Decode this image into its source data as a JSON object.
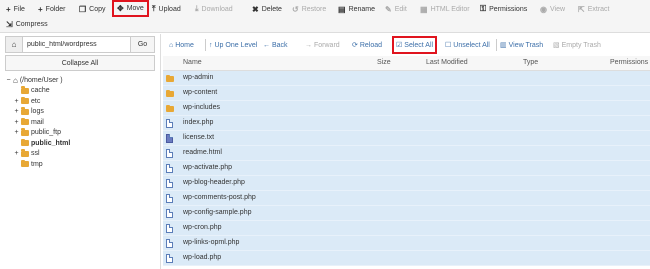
{
  "toolbar": {
    "file": "File",
    "folder": "Folder",
    "copy": "Copy",
    "move": "Move",
    "upload": "Upload",
    "download": "Download",
    "delete": "Delete",
    "restore": "Restore",
    "rename": "Rename",
    "edit": "Edit",
    "html_editor": "HTML Editor",
    "permissions": "Permissions",
    "view": "View",
    "extract": "Extract",
    "compress": "Compress"
  },
  "path": {
    "value": "public_html/wordpress",
    "go": "Go"
  },
  "collapse_all": "Collapse All",
  "tree": [
    {
      "prefix": "−",
      "label": "(/home/User )",
      "bold": false,
      "home": true,
      "indent": 0
    },
    {
      "prefix": "",
      "label": "cache",
      "bold": false,
      "indent": 1
    },
    {
      "prefix": "+",
      "label": "etc",
      "bold": false,
      "indent": 1
    },
    {
      "prefix": "+",
      "label": "logs",
      "bold": false,
      "indent": 1
    },
    {
      "prefix": "+",
      "label": "mail",
      "bold": false,
      "indent": 1
    },
    {
      "prefix": "+",
      "label": "public_ftp",
      "bold": false,
      "indent": 1
    },
    {
      "prefix": "",
      "label": "public_html",
      "bold": true,
      "indent": 1
    },
    {
      "prefix": "+",
      "label": "ssl",
      "bold": false,
      "indent": 1
    },
    {
      "prefix": "",
      "label": "tmp",
      "bold": false,
      "indent": 1
    }
  ],
  "nav": {
    "home": "Home",
    "up": "Up One Level",
    "back": "Back",
    "forward": "Forward",
    "reload": "Reload",
    "select_all": "Select All",
    "unselect_all": "Unselect All",
    "view_trash": "View Trash",
    "empty_trash": "Empty Trash"
  },
  "columns": {
    "name": "Name",
    "size": "Size",
    "modified": "Last Modified",
    "type": "Type",
    "permissions": "Permissions"
  },
  "files": [
    {
      "name": "wp-admin",
      "kind": "folder"
    },
    {
      "name": "wp-content",
      "kind": "folder"
    },
    {
      "name": "wp-includes",
      "kind": "folder"
    },
    {
      "name": "index.php",
      "kind": "file"
    },
    {
      "name": "license.txt",
      "kind": "txt"
    },
    {
      "name": "readme.html",
      "kind": "file"
    },
    {
      "name": "wp-activate.php",
      "kind": "file"
    },
    {
      "name": "wp-blog-header.php",
      "kind": "file"
    },
    {
      "name": "wp-comments-post.php",
      "kind": "file"
    },
    {
      "name": "wp-config-sample.php",
      "kind": "file"
    },
    {
      "name": "wp-cron.php",
      "kind": "file"
    },
    {
      "name": "wp-links-opml.php",
      "kind": "file"
    },
    {
      "name": "wp-load.php",
      "kind": "file"
    }
  ]
}
